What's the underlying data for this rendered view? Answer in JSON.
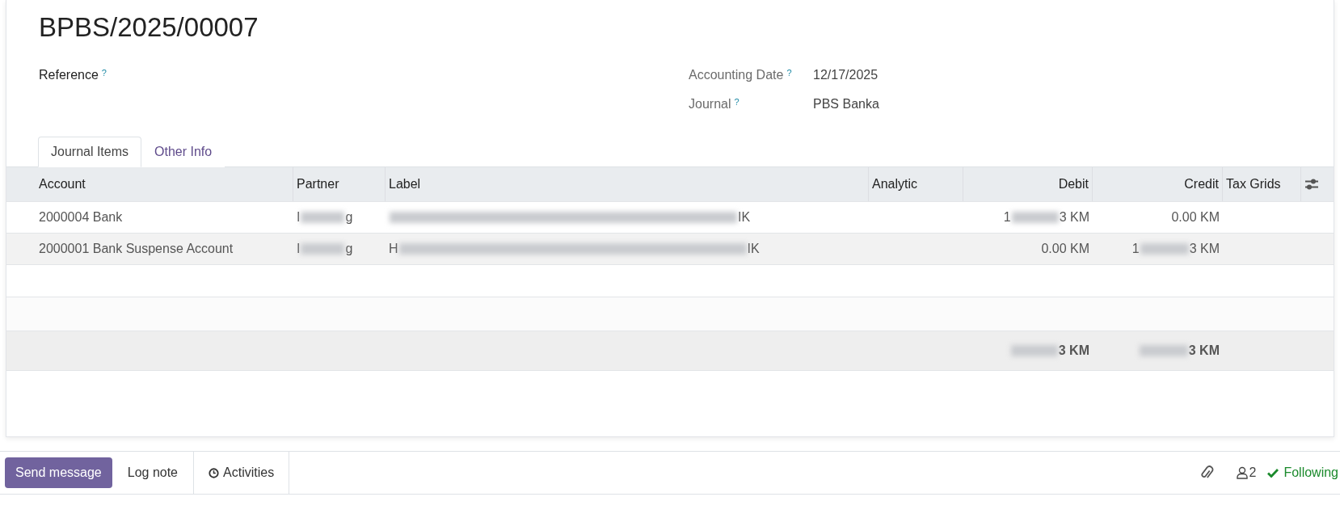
{
  "title": "BPBS/2025/00007",
  "fields_left": [
    {
      "label": "Reference",
      "help": "?"
    }
  ],
  "fields_right": [
    {
      "label": "Accounting Date",
      "help": "?",
      "value": "12/17/2025"
    },
    {
      "label": "Journal",
      "help": "?",
      "value": "PBS Banka"
    }
  ],
  "tabs": [
    {
      "label": "Journal Items",
      "selected": true
    },
    {
      "label": "Other Info",
      "selected": false
    }
  ],
  "table": {
    "columns": [
      "Account",
      "Partner",
      "Label",
      "Analytic",
      "Debit",
      "Credit",
      "Tax Grids"
    ],
    "rows": [
      {
        "account": {
          "text": "2000004 Bank"
        },
        "partner": {
          "start": "I",
          "end": "g"
        },
        "label": {
          "end": "IK"
        },
        "debit": {
          "start": "1",
          "end": "3 KM"
        },
        "credit": {
          "text": "0.00 KM"
        }
      },
      {
        "account": {
          "text": "2000001 Bank Suspense Account"
        },
        "partner": {
          "start": "I",
          "end": "g"
        },
        "label": {
          "start": "H",
          "end": "IK"
        },
        "debit": {
          "text": "0.00 KM"
        },
        "credit": {
          "start": "1",
          "end": "3 KM"
        }
      }
    ],
    "totals": {
      "debit": {
        "end": "3 KM"
      },
      "credit": {
        "end": "3 KM"
      }
    }
  },
  "chatter": {
    "buttons": [
      {
        "label": "Send message",
        "kind": "primary"
      },
      {
        "label": "Log note",
        "kind": "plain"
      },
      {
        "label": "Activities",
        "kind": "activity"
      }
    ],
    "followers": "2",
    "following": "Following"
  }
}
